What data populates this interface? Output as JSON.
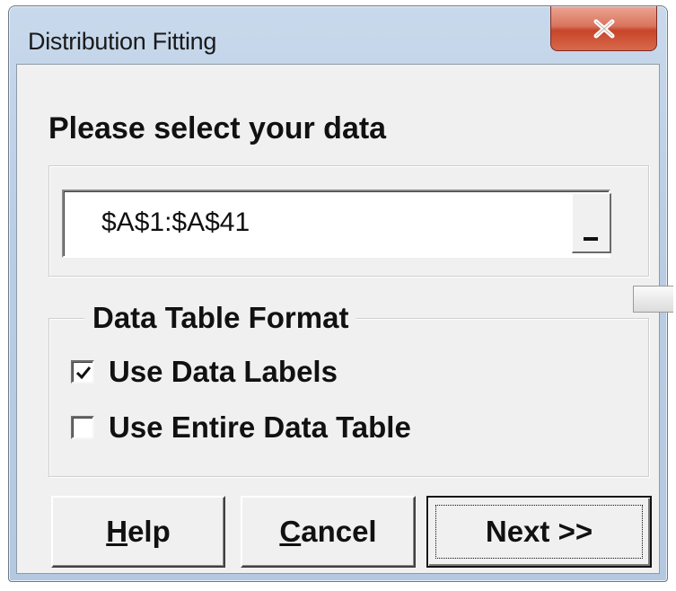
{
  "window": {
    "title": "Distribution Fitting",
    "close_glyph": "x",
    "accent_close": "#c7452a",
    "titlebar_color": "#b9cde5"
  },
  "data_selection": {
    "heading": "Please select your data",
    "range_value": "$A$1:$A$41"
  },
  "format": {
    "legend": "Data Table Format",
    "options": [
      {
        "label": "Use Data Labels",
        "checked": true
      },
      {
        "label": "Use Entire Data Table",
        "checked": false
      }
    ]
  },
  "buttons": {
    "help": {
      "mnemonic": "H",
      "rest": "elp"
    },
    "cancel": {
      "mnemonic": "C",
      "rest": "ancel"
    },
    "next": {
      "label": "Next >>"
    }
  }
}
